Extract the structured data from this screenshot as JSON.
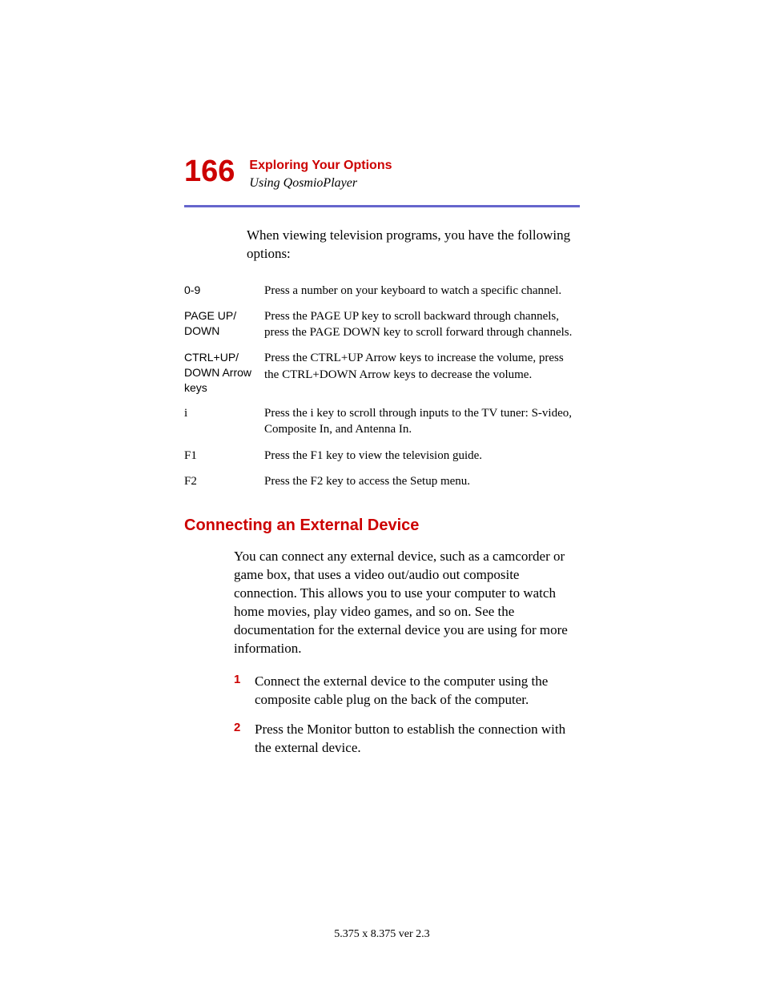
{
  "header": {
    "page_number": "166",
    "chapter_title": "Exploring Your Options",
    "section_subtitle": "Using QosmioPlayer"
  },
  "intro": "When viewing television programs, you have the following options:",
  "options": [
    {
      "key_lines": [
        "0-9"
      ],
      "key_serif": false,
      "desc": "Press a number on your keyboard to watch a specific channel."
    },
    {
      "key_lines": [
        "PAGE UP/",
        "DOWN"
      ],
      "key_serif": false,
      "desc": "Press the PAGE UP key to scroll backward through channels, press the PAGE DOWN key to scroll forward through channels."
    },
    {
      "key_lines": [
        "CTRL+UP/",
        "DOWN Arrow",
        "keys"
      ],
      "key_serif": false,
      "desc": "Press the CTRL+UP Arrow keys to increase the volume, press the CTRL+DOWN Arrow keys to decrease the volume."
    },
    {
      "key_lines": [
        "i"
      ],
      "key_serif": true,
      "desc": "Press the i key to scroll through inputs to the TV tuner: S-video, Composite In, and Antenna In."
    },
    {
      "key_lines": [
        "F1"
      ],
      "key_serif": true,
      "desc": "Press the F1 key to view the television guide."
    },
    {
      "key_lines": [
        "F2"
      ],
      "key_serif": true,
      "desc": "Press the F2 key to access the Setup menu."
    }
  ],
  "section": {
    "heading": "Connecting an External Device",
    "paragraph": "You can connect any external device, such as a camcorder or game box, that uses a video out/audio out composite connection. This allows you to use your computer to watch home movies, play video games, and so on. See the documentation for the external device you are using for more information.",
    "steps": [
      {
        "num": "1",
        "text": "Connect the external device to the computer using the composite cable plug on the back of the computer."
      },
      {
        "num": "2",
        "text": "Press the Monitor button to establish the connection with the external device."
      }
    ]
  },
  "footer": "5.375 x 8.375 ver 2.3"
}
